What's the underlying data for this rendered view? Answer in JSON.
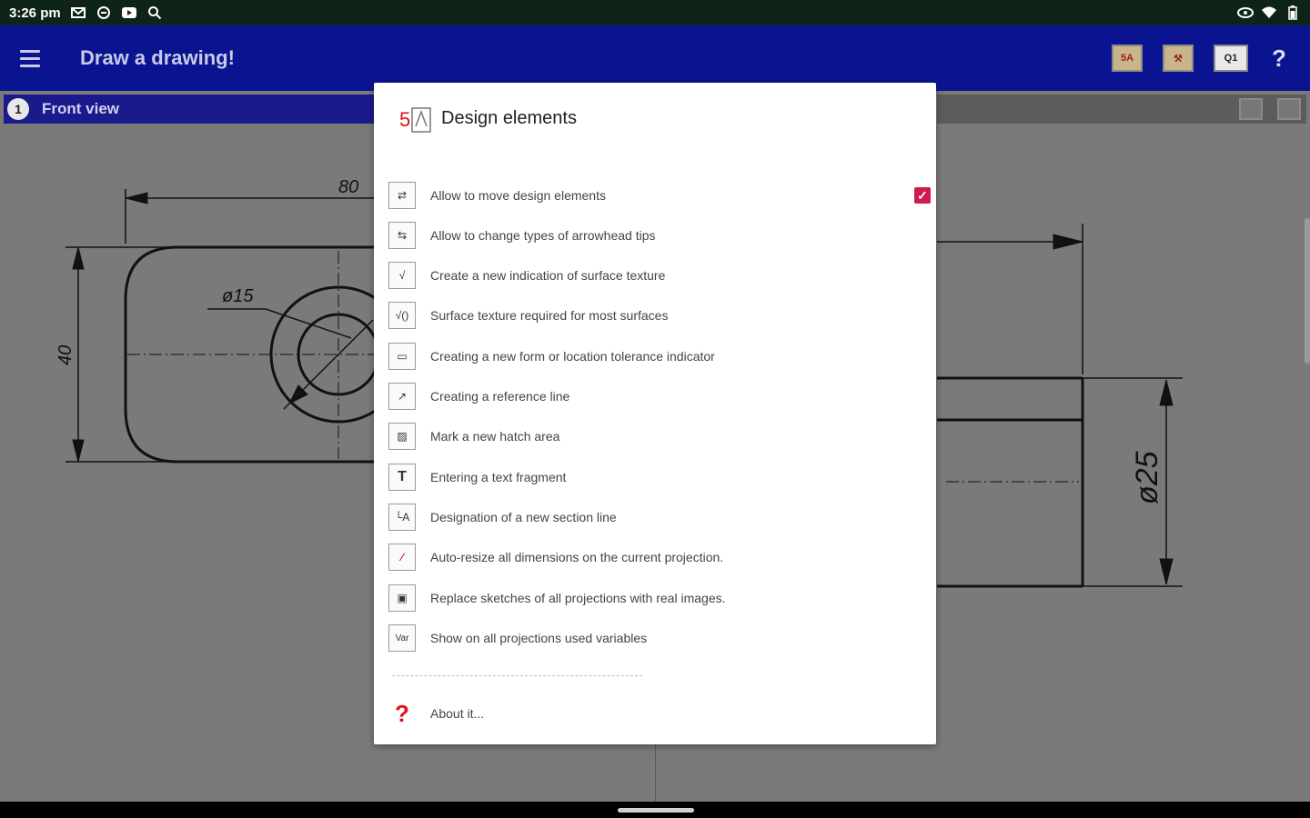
{
  "status_bar": {
    "time": "3:26 pm",
    "left_icons": [
      "mail-icon",
      "sync-icon",
      "video-icon",
      "search-icon"
    ],
    "right_icons": [
      "eye-icon",
      "wifi-icon",
      "battery-icon"
    ]
  },
  "app_bar": {
    "title": "Draw a drawing!",
    "tool_1": "5A",
    "tool_2": "⚒",
    "tool_3": "Q1",
    "help": "?"
  },
  "canvas": {
    "view_number": "1",
    "view_title": "Front view",
    "dim_80": "80",
    "dim_15": "ø15",
    "dim_40": "40",
    "dim_25": "ø25"
  },
  "dialog": {
    "title": "Design elements",
    "header_icon_number": "5",
    "items": [
      {
        "label": "Allow to move design elements",
        "icon": "move-dimension-icon",
        "glyph": "⇄",
        "checked": true
      },
      {
        "label": "Allow to change types of arrowhead tips",
        "icon": "arrowhead-icon",
        "glyph": "⇆"
      },
      {
        "label": "Create a new indication of surface texture",
        "icon": "surface-texture-icon",
        "glyph": "√"
      },
      {
        "label": "Surface texture required for most surfaces",
        "icon": "surface-texture-all-icon",
        "glyph": "√()"
      },
      {
        "label": "Creating a new form or location tolerance indicator",
        "icon": "tolerance-icon",
        "glyph": "▭"
      },
      {
        "label": "Creating a reference line",
        "icon": "reference-line-icon",
        "glyph": "↗"
      },
      {
        "label": "Mark a new hatch area",
        "icon": "hatch-icon",
        "glyph": "▨"
      },
      {
        "label": "Entering a text fragment",
        "icon": "text-icon",
        "glyph": "T"
      },
      {
        "label": "Designation of a new section line",
        "icon": "section-line-icon",
        "glyph": "└A"
      },
      {
        "label": "Auto-resize all dimensions on the current projection.",
        "icon": "auto-resize-icon",
        "glyph": "∕"
      },
      {
        "label": "Replace sketches of all projections with real images.",
        "icon": "replace-sketch-icon",
        "glyph": "▣"
      },
      {
        "label": "Show on all projections used variables",
        "icon": "variables-icon",
        "glyph": "Var"
      }
    ],
    "about_label": "About it...",
    "about_glyph": "?"
  }
}
